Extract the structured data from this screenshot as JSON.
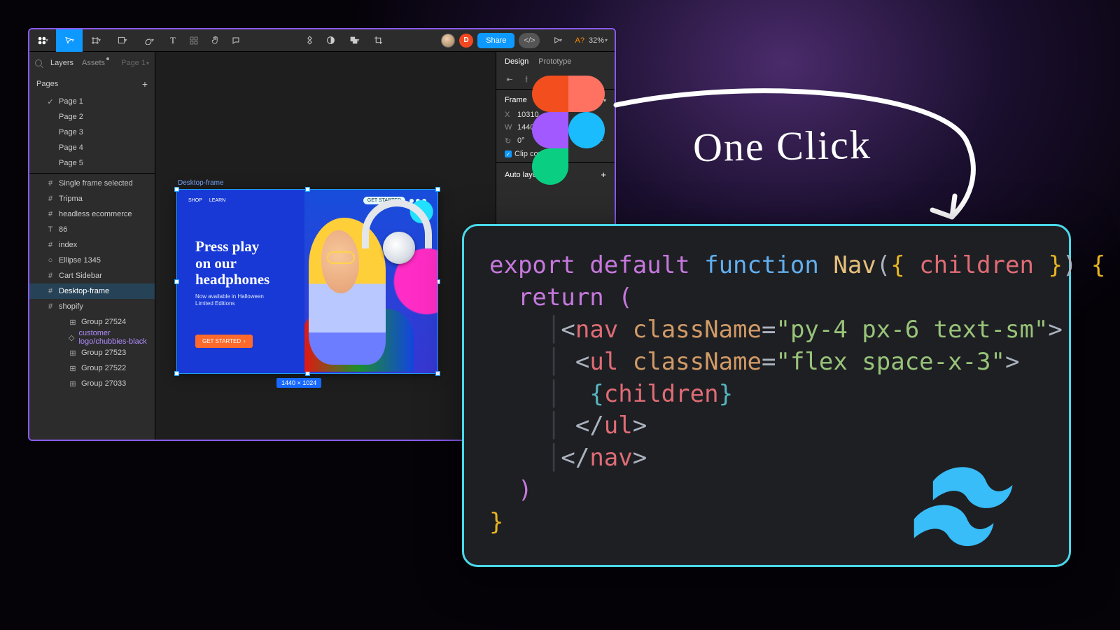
{
  "handwriting": "One Click",
  "figma": {
    "share": "Share",
    "avatar_initial": "D",
    "zoom": "32%",
    "missing_fonts": "A?",
    "left": {
      "tab_layers": "Layers",
      "tab_assets": "Assets",
      "page_picker": "Page 1",
      "pages_header": "Pages",
      "pages": [
        "Page 1",
        "Page 2",
        "Page 3",
        "Page 4",
        "Page 5"
      ],
      "layers": [
        {
          "icon": "frame",
          "label": "Single frame selected"
        },
        {
          "icon": "frame",
          "label": "Tripma"
        },
        {
          "icon": "frame",
          "label": "headless ecommerce"
        },
        {
          "icon": "text",
          "label": "86"
        },
        {
          "icon": "frame",
          "label": "index"
        },
        {
          "icon": "ellipse",
          "label": "Ellipse 1345"
        },
        {
          "icon": "frame",
          "label": "Cart Sidebar"
        },
        {
          "icon": "frame",
          "label": "Desktop-frame",
          "selected": true
        },
        {
          "icon": "frame",
          "label": "shopify",
          "expanded": true
        },
        {
          "icon": "group",
          "label": "Group 27524",
          "indent": 3
        },
        {
          "icon": "component",
          "label": "customer logo/chubbies-black",
          "indent": 3,
          "purple": true
        },
        {
          "icon": "group",
          "label": "Group 27523",
          "indent": 3
        },
        {
          "icon": "group",
          "label": "Group 27522",
          "indent": 3
        },
        {
          "icon": "group",
          "label": "Group 27033",
          "indent": 3
        }
      ]
    },
    "canvas": {
      "frame_label": "Desktop-frame",
      "dim_badge": "1440 × 1024",
      "nav_shop": "SHOP",
      "nav_learn": "LEARN",
      "nav_cta": "GET STARTED",
      "hero_title_l1": "Press play",
      "hero_title_l2": "on our",
      "hero_title_l3": "headphones",
      "hero_sub_l1": "Now available in Halloween",
      "hero_sub_l2": "Limited Editions",
      "hero_cta": "GET STARTED"
    },
    "right": {
      "tab_design": "Design",
      "tab_prototype": "Prototype",
      "section_frame": "Frame",
      "x_label": "X",
      "x_value": "10310",
      "w_label": "W",
      "w_value": "1440",
      "rot_label": "↻",
      "rot_value": "0°",
      "clip_label": "Clip content",
      "section_autolayout": "Auto layout"
    }
  },
  "code": {
    "l1": {
      "export": "export",
      "default": "default",
      "function": "function",
      "name": "Nav",
      "children": "children"
    },
    "l2": {
      "return": "return"
    },
    "l3": {
      "tag": "nav",
      "attr": "className",
      "val": "\"py-4 px-6 text-sm\""
    },
    "l4": {
      "tag": "ul",
      "attr": "className",
      "val": "\"flex space-x-3\""
    },
    "l5": {
      "children": "children"
    },
    "l6": {
      "tag": "ul"
    },
    "l7": {
      "tag": "nav"
    }
  }
}
